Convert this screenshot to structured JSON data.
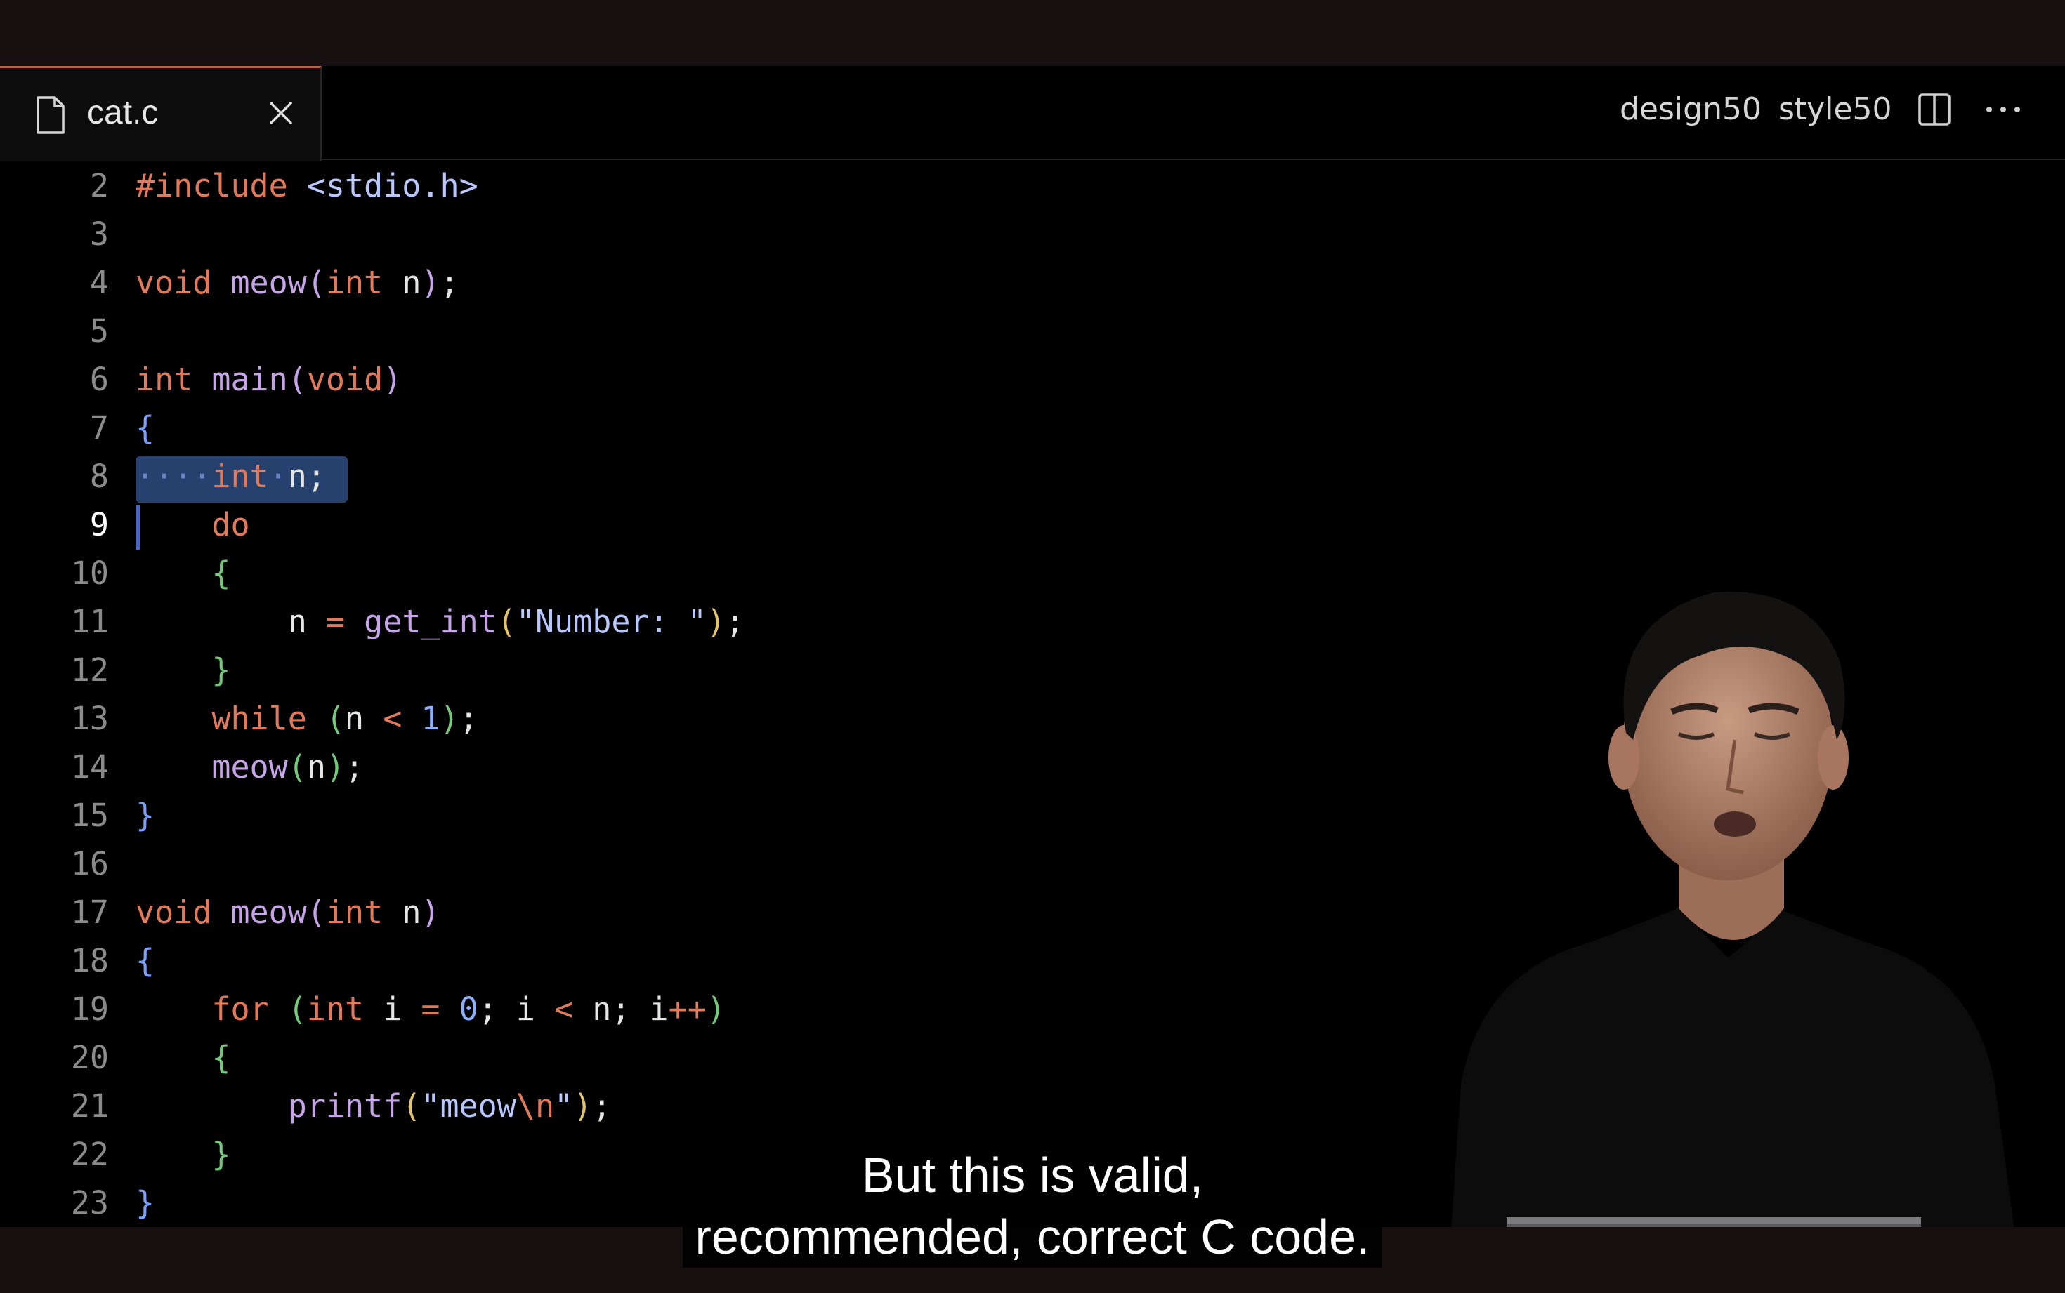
{
  "tab": {
    "filename": "cat.c"
  },
  "toolbar": {
    "design50_label": "design50",
    "style50_label": "style50",
    "split_icon": "split-editor-icon",
    "more_icon": "more-actions-icon"
  },
  "editor": {
    "current_line": 9,
    "lines": [
      {
        "num": "2",
        "tokens": [
          [
            "kw",
            "#include "
          ],
          [
            "str",
            "<stdio.h>"
          ]
        ]
      },
      {
        "num": "3",
        "tokens": []
      },
      {
        "num": "4",
        "tokens": [
          [
            "kw",
            "void "
          ],
          [
            "fn",
            "meow"
          ],
          [
            "br4",
            "("
          ],
          [
            "kw",
            "int "
          ],
          [
            "plain",
            "n"
          ],
          [
            "br4",
            ")"
          ],
          [
            "plain",
            ";"
          ]
        ]
      },
      {
        "num": "5",
        "tokens": []
      },
      {
        "num": "6",
        "tokens": [
          [
            "kw",
            "int "
          ],
          [
            "fn",
            "main"
          ],
          [
            "br4",
            "("
          ],
          [
            "kw",
            "void"
          ],
          [
            "br4",
            ")"
          ]
        ]
      },
      {
        "num": "7",
        "tokens": [
          [
            "br1",
            "{"
          ]
        ]
      },
      {
        "num": "8",
        "tokens": [
          [
            "ws",
            "····"
          ],
          [
            "kw",
            "int"
          ],
          [
            "ws",
            "·"
          ],
          [
            "plain",
            "n;"
          ]
        ]
      },
      {
        "num": "9",
        "tokens": [
          [
            "plain",
            "    "
          ],
          [
            "kw",
            "do"
          ]
        ]
      },
      {
        "num": "10",
        "tokens": [
          [
            "plain",
            "    "
          ],
          [
            "br3",
            "{"
          ]
        ]
      },
      {
        "num": "11",
        "tokens": [
          [
            "plain",
            "        n "
          ],
          [
            "op",
            "= "
          ],
          [
            "fn",
            "get_int"
          ],
          [
            "br2",
            "("
          ],
          [
            "str",
            "\"Number: \""
          ],
          [
            "br2",
            ")"
          ],
          [
            "plain",
            ";"
          ]
        ]
      },
      {
        "num": "12",
        "tokens": [
          [
            "plain",
            "    "
          ],
          [
            "br3",
            "}"
          ]
        ]
      },
      {
        "num": "13",
        "tokens": [
          [
            "plain",
            "    "
          ],
          [
            "kw",
            "while "
          ],
          [
            "br3",
            "("
          ],
          [
            "plain",
            "n "
          ],
          [
            "op",
            "< "
          ],
          [
            "num",
            "1"
          ],
          [
            "br3",
            ")"
          ],
          [
            "plain",
            ";"
          ]
        ]
      },
      {
        "num": "14",
        "tokens": [
          [
            "plain",
            "    "
          ],
          [
            "fn",
            "meow"
          ],
          [
            "br3",
            "("
          ],
          [
            "plain",
            "n"
          ],
          [
            "br3",
            ")"
          ],
          [
            "plain",
            ";"
          ]
        ]
      },
      {
        "num": "15",
        "tokens": [
          [
            "br1",
            "}"
          ]
        ]
      },
      {
        "num": "16",
        "tokens": []
      },
      {
        "num": "17",
        "tokens": [
          [
            "kw",
            "void "
          ],
          [
            "fn",
            "meow"
          ],
          [
            "br4",
            "("
          ],
          [
            "kw",
            "int "
          ],
          [
            "plain",
            "n"
          ],
          [
            "br4",
            ")"
          ]
        ]
      },
      {
        "num": "18",
        "tokens": [
          [
            "br1",
            "{"
          ]
        ]
      },
      {
        "num": "19",
        "tokens": [
          [
            "plain",
            "    "
          ],
          [
            "kw",
            "for "
          ],
          [
            "br3",
            "("
          ],
          [
            "kw",
            "int "
          ],
          [
            "plain",
            "i "
          ],
          [
            "op",
            "= "
          ],
          [
            "num",
            "0"
          ],
          [
            "plain",
            "; i "
          ],
          [
            "op",
            "< "
          ],
          [
            "plain",
            "n; i"
          ],
          [
            "op",
            "++"
          ],
          [
            "br3",
            ")"
          ]
        ]
      },
      {
        "num": "20",
        "tokens": [
          [
            "plain",
            "    "
          ],
          [
            "br3",
            "{"
          ]
        ]
      },
      {
        "num": "21",
        "tokens": [
          [
            "plain",
            "        "
          ],
          [
            "fn",
            "printf"
          ],
          [
            "br2",
            "("
          ],
          [
            "str",
            "\"meow"
          ],
          [
            "esc",
            "\\n"
          ],
          [
            "str",
            "\""
          ],
          [
            "br2",
            ")"
          ],
          [
            "plain",
            ";"
          ]
        ]
      },
      {
        "num": "22",
        "tokens": [
          [
            "plain",
            "    "
          ],
          [
            "br3",
            "}"
          ]
        ]
      },
      {
        "num": "23",
        "tokens": [
          [
            "br1",
            "}"
          ]
        ]
      }
    ]
  },
  "captions": {
    "line1": "But this is valid,",
    "line2": "recommended, correct C code."
  },
  "icons": {
    "file": "file-icon",
    "close": "close-icon"
  }
}
